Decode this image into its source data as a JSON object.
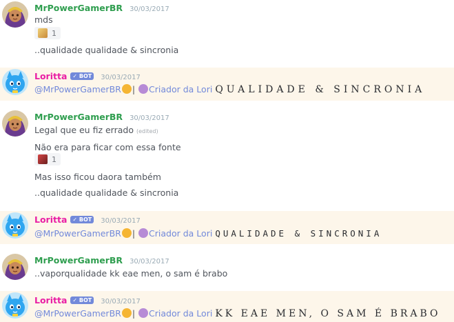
{
  "messages": [
    {
      "author": "MrPowerGamerBR",
      "timestamp": "30/03/2017",
      "lines": [
        "mds",
        "..qualidade qualidade & sincronia"
      ],
      "reaction_count": "1"
    },
    {
      "author": "Loritta",
      "bot_tag": "✓ BOT",
      "timestamp": "30/03/2017",
      "mention": "@MrPowerGamerBR",
      "separator": "|",
      "creator_label": "Criador da Lori",
      "wide_text": "QUALIDADE & SINCRONIA"
    },
    {
      "author": "MrPowerGamerBR",
      "timestamp": "30/03/2017",
      "line1": "Legal que eu fiz errado",
      "edited": "(edited)",
      "line2": "Não era para ficar com essa fonte",
      "reaction_count": "1",
      "line3": "Mas isso ficou daora também",
      "line4": "..qualidade qualidade & sincronia"
    },
    {
      "author": "Loritta",
      "bot_tag": "✓ BOT",
      "timestamp": "30/03/2017",
      "mention": "@MrPowerGamerBR",
      "separator": "|",
      "creator_label": "Criador da Lori",
      "wide_text": "QUALIDADE & SINCRONIA"
    },
    {
      "author": "MrPowerGamerBR",
      "timestamp": "30/03/2017",
      "line1": "..vaporqualidade kk eae men, o sam é brabo"
    },
    {
      "author": "Loritta",
      "bot_tag": "✓ BOT",
      "timestamp": "30/03/2017",
      "mention": "@MrPowerGamerBR",
      "separator": "|",
      "creator_label": "Criador da Lori",
      "wide_text": "KK EAE MEN, O SAM É BRABO"
    }
  ],
  "icons": {
    "user_avatar": "shantae-avatar",
    "bot_avatar": "loritta-avatar",
    "reaction_1": "qualidade-emoji",
    "reaction_2": "red-emoji",
    "mention_emoji": "kissing-face-emoji",
    "creator_emoji": "person-tipping-hand-emoji"
  },
  "colors": {
    "user_name": "#2f9e4f",
    "bot_name": "#e91ea4",
    "bot_tag": "#7289da",
    "bot_bg": "#fdf6ea"
  }
}
